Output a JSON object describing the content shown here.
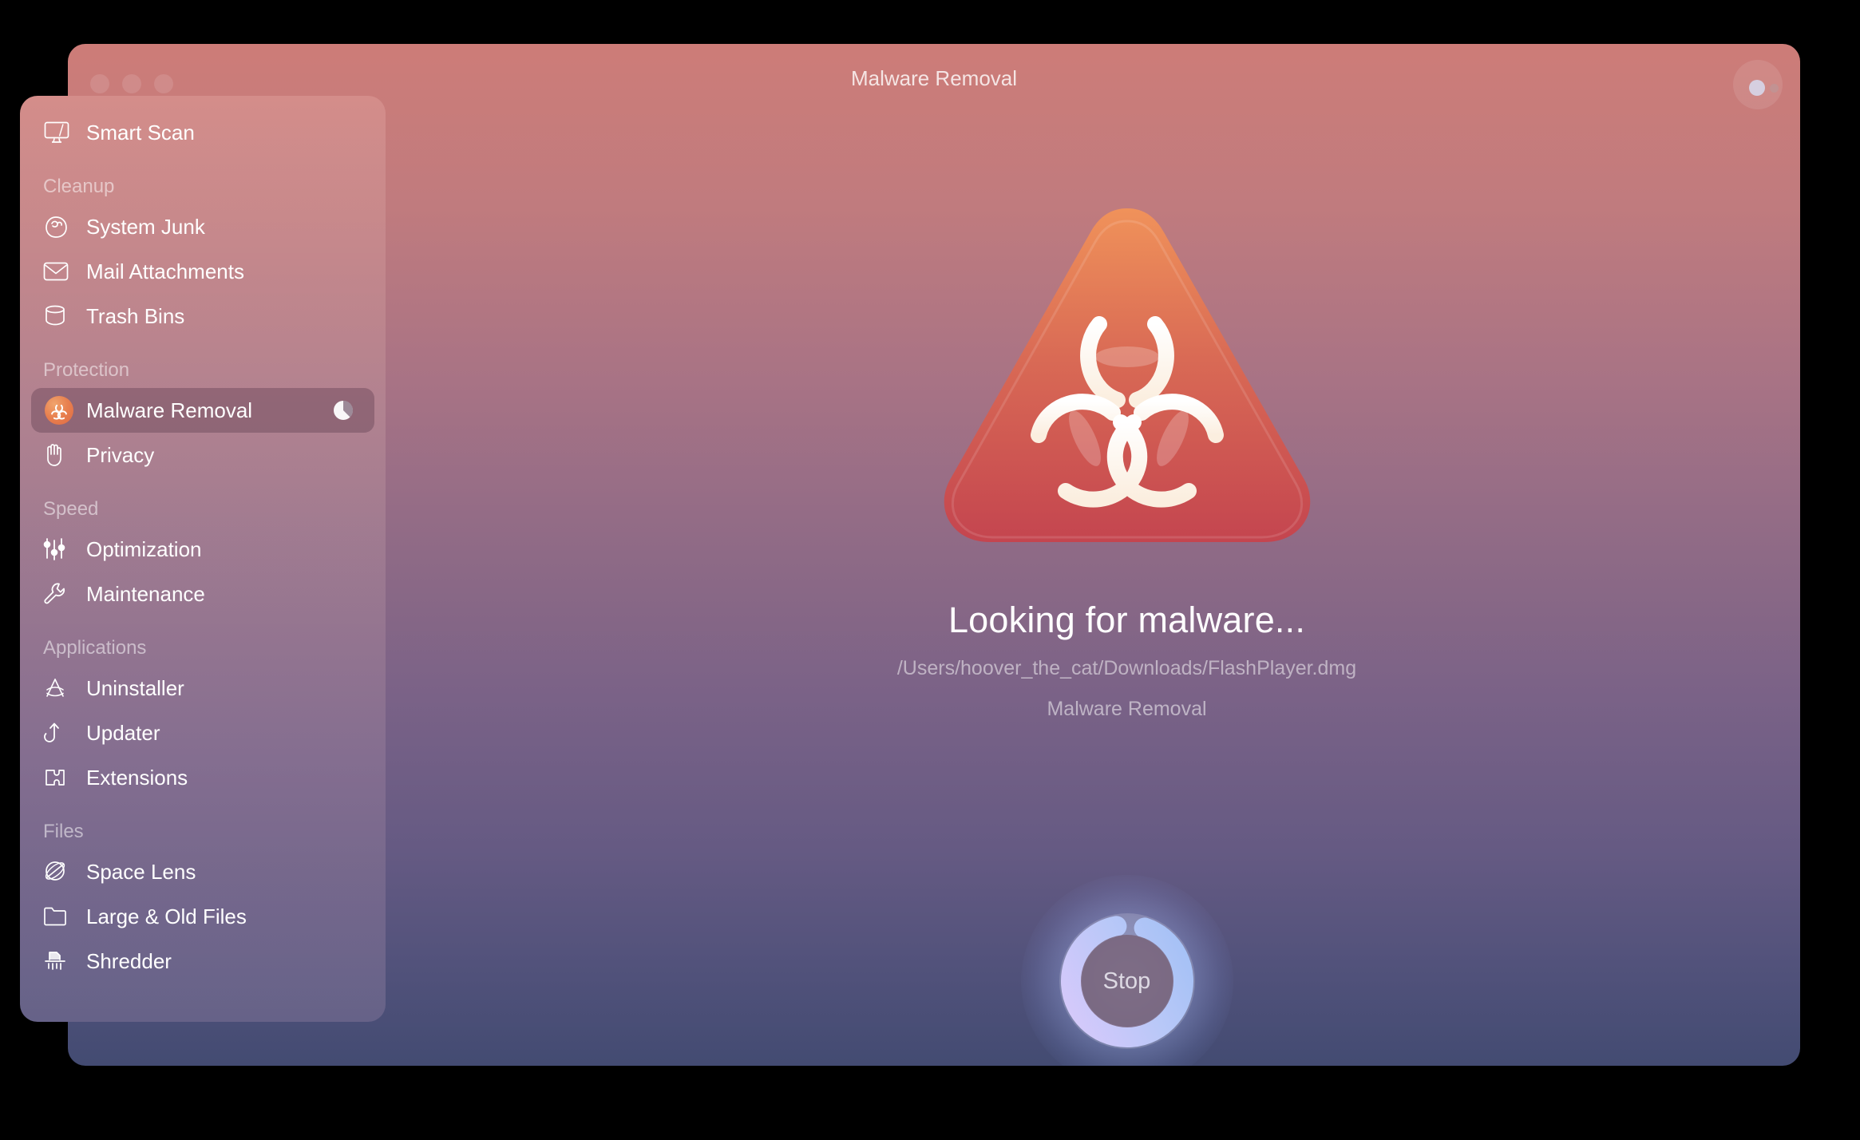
{
  "window": {
    "title": "Malware Removal",
    "traffic_lights": [
      "close",
      "minimize",
      "maximize"
    ],
    "menu_button": "menu-button"
  },
  "sidebar": {
    "top_item": {
      "label": "Smart Scan",
      "icon": "display-scan-icon"
    },
    "sections": [
      {
        "title": "Cleanup",
        "items": [
          {
            "label": "System Junk",
            "icon": "junk-icon"
          },
          {
            "label": "Mail Attachments",
            "icon": "envelope-icon"
          },
          {
            "label": "Trash Bins",
            "icon": "trash-bin-icon"
          }
        ]
      },
      {
        "title": "Protection",
        "items": [
          {
            "label": "Malware Removal",
            "icon": "biohazard-icon",
            "selected": true,
            "progress": 0.72
          },
          {
            "label": "Privacy",
            "icon": "hand-icon"
          }
        ]
      },
      {
        "title": "Speed",
        "items": [
          {
            "label": "Optimization",
            "icon": "sliders-icon"
          },
          {
            "label": "Maintenance",
            "icon": "wrench-icon"
          }
        ]
      },
      {
        "title": "Applications",
        "items": [
          {
            "label": "Uninstaller",
            "icon": "appstore-icon"
          },
          {
            "label": "Updater",
            "icon": "update-arrow-icon"
          },
          {
            "label": "Extensions",
            "icon": "puzzle-piece-icon"
          }
        ]
      },
      {
        "title": "Files",
        "items": [
          {
            "label": "Space Lens",
            "icon": "space-lens-icon"
          },
          {
            "label": "Large & Old Files",
            "icon": "folder-icon"
          },
          {
            "label": "Shredder",
            "icon": "shredder-icon"
          }
        ]
      }
    ]
  },
  "main": {
    "hero_icon": "biohazard-triangle-icon",
    "status_title": "Looking for malware...",
    "status_path": "/Users/hoover_the_cat/Downloads/FlashPlayer.dmg",
    "status_module": "Malware Removal",
    "stop_button": {
      "label": "Stop",
      "progress": 0.92
    }
  },
  "colors": {
    "window_top": "#cd7c78",
    "window_bottom": "#434b72",
    "hazard_orange": "#ef8b55",
    "hazard_red": "#c9494f",
    "progress_ring": "#a9c4f5",
    "accent_lavender": "#cfc0f7"
  }
}
